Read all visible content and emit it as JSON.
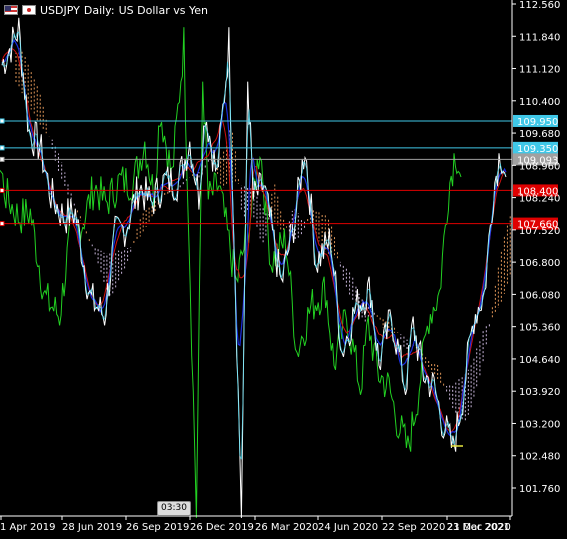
{
  "header": {
    "symbol": "USDJPY",
    "timeframe": "Daily:",
    "description": "US Dollar vs Yen",
    "flag_left": "us-flag-icon",
    "flag_right": "jp-flag-icon"
  },
  "countdown": "03:30",
  "colors": {
    "background": "#000000",
    "price_line": "#ffffff",
    "ma_blue": "#1a2ee0",
    "ma_red": "#d01010",
    "chikou_green": "#22d022",
    "cloud_orange": "#f4a460",
    "cloud_violet": "#dcc8f0",
    "hline_cyan": "#40c8e8",
    "hline_red": "#e00000",
    "current_price": "#a0a0a0"
  },
  "chart_data": {
    "type": "line",
    "y_axis_labels": [
      "112.560",
      "111.840",
      "111.120",
      "110.400",
      "109.680",
      "108.960",
      "108.240",
      "107.520",
      "106.800",
      "106.080",
      "105.360",
      "104.640",
      "103.920",
      "103.200",
      "102.480",
      "101.760"
    ],
    "x_axis_labels": [
      "1 Apr 2019",
      "28 Jun 2019",
      "26 Sep 2019",
      "26 Dec 2019",
      "26 Mar 2020",
      "24 Jun 2020",
      "22 Sep 2020",
      "21 Dec 2020",
      "23 Mar 2021"
    ],
    "ylim": [
      101.3,
      112.6
    ],
    "x_range": [
      "2019-04-01",
      "2021-03-23"
    ],
    "horizontal_levels": [
      {
        "value": 109.95,
        "label": "109.950",
        "color": "#40c8e8"
      },
      {
        "value": 109.35,
        "label": "109.350",
        "color": "#40c8e8"
      },
      {
        "value": 109.093,
        "label": "109.093",
        "color": "#a0a0a0"
      },
      {
        "value": 108.4,
        "label": "108.400",
        "color": "#e00000"
      },
      {
        "value": 107.66,
        "label": "107.660",
        "color": "#e00000"
      }
    ],
    "series": [
      {
        "values": [
          [
            "2019-04-01",
            111.2
          ],
          [
            "2019-04-25",
            112.0
          ],
          [
            "2019-05-10",
            109.7
          ],
          [
            "2019-05-25",
            109.4
          ],
          [
            "2019-06-10",
            108.3
          ],
          [
            "2019-06-28",
            107.8
          ],
          [
            "2019-07-15",
            107.9
          ],
          [
            "2019-08-05",
            106.0
          ],
          [
            "2019-08-26",
            105.6
          ],
          [
            "2019-09-10",
            107.4
          ],
          [
            "2019-09-26",
            107.6
          ],
          [
            "2019-10-15",
            108.5
          ],
          [
            "2019-10-31",
            108.1
          ],
          [
            "2019-11-20",
            108.6
          ],
          [
            "2019-12-10",
            108.6
          ],
          [
            "2019-12-26",
            109.5
          ],
          [
            "2020-01-08",
            108.3
          ],
          [
            "2020-01-17",
            110.2
          ],
          [
            "2020-02-03",
            108.7
          ],
          [
            "2020-02-20",
            111.7
          ],
          [
            "2020-03-09",
            101.2
          ],
          [
            "2020-03-18",
            110.9
          ],
          [
            "2020-03-26",
            108.2
          ],
          [
            "2020-04-10",
            108.5
          ],
          [
            "2020-05-05",
            106.3
          ],
          [
            "2020-05-25",
            107.8
          ],
          [
            "2020-06-08",
            109.4
          ],
          [
            "2020-06-24",
            106.8
          ],
          [
            "2020-07-15",
            107.3
          ],
          [
            "2020-07-31",
            104.8
          ],
          [
            "2020-08-20",
            105.8
          ],
          [
            "2020-09-10",
            106.2
          ],
          [
            "2020-09-22",
            104.5
          ],
          [
            "2020-10-10",
            105.6
          ],
          [
            "2020-10-30",
            104.0
          ],
          [
            "2020-11-10",
            105.4
          ],
          [
            "2020-11-25",
            104.3
          ],
          [
            "2020-12-10",
            104.0
          ],
          [
            "2020-12-21",
            103.3
          ],
          [
            "2021-01-06",
            102.6
          ],
          [
            "2021-01-20",
            103.8
          ],
          [
            "2021-02-05",
            105.6
          ],
          [
            "2021-02-20",
            106.1
          ],
          [
            "2021-03-05",
            108.4
          ],
          [
            "2021-03-15",
            109.3
          ],
          [
            "2021-03-23",
            108.7
          ]
        ]
      }
    ]
  }
}
